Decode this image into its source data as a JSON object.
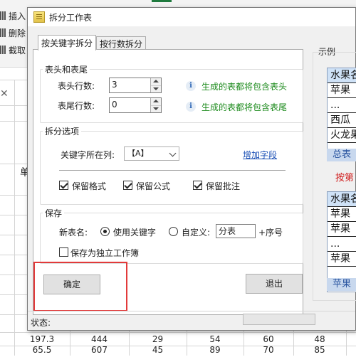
{
  "spreadsheet": {
    "ribbon_items": [
      "插入",
      "删除",
      "截取"
    ],
    "header_fragment": "单",
    "close_mark": "✕",
    "rows": [
      [
        "197.3",
        "444",
        "29",
        "54",
        "60",
        "48"
      ],
      [
        "65.5",
        "607",
        "45",
        "89",
        "70",
        "85"
      ]
    ]
  },
  "dialog": {
    "title": "拆分工作表",
    "tabs": [
      "按关键字拆分",
      "按行数拆分"
    ],
    "header_footer": {
      "legend": "表头和表尾",
      "header_rows_label": "表头行数:",
      "header_rows_value": "3",
      "footer_rows_label": "表尾行数:",
      "footer_rows_value": "0",
      "info_glyph": "i",
      "header_hint": "生成的表都将包含表头",
      "footer_hint": "生成的表都将包含表尾"
    },
    "split_options": {
      "legend": "拆分选项",
      "keyword_column_label": "关键字所在列:",
      "keyword_column_value": "【A】",
      "add_field_link": "增加字段",
      "checkboxes": [
        {
          "label": "保留格式",
          "checked": true
        },
        {
          "label": "保留公式",
          "checked": true
        },
        {
          "label": "保留批注",
          "checked": true
        }
      ]
    },
    "save": {
      "legend": "保存",
      "new_table_name_label": "新表名:",
      "radio_keyword_label": "使用关键字",
      "radio_keyword_checked": true,
      "radio_custom_label": "自定义:",
      "radio_custom_checked": false,
      "custom_value": "分表",
      "suffix": "+序号",
      "independent_workbook_label": "保存为独立工作簿",
      "independent_workbook_checked": false
    },
    "buttons": {
      "confirm": "确定",
      "exit": "退出"
    },
    "status_label": "状态:",
    "example": {
      "legend": "示例",
      "table1_rows": [
        "水果名",
        "苹果",
        "...",
        "西瓜",
        "火龙果"
      ],
      "table1_tab": "总表",
      "caption": "按第",
      "table2_rows": [
        "水果名",
        "苹果",
        "苹果",
        "...",
        "苹果"
      ],
      "table2_tab": "苹果"
    }
  }
}
